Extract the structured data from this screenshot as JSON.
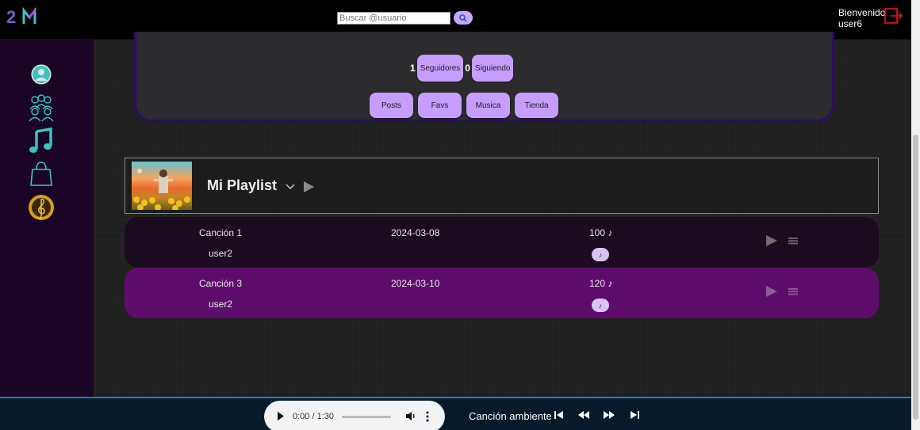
{
  "header": {
    "logo_text": "2M",
    "search_placeholder": "Buscar @usuario",
    "welcome_line1": "Bienvenido",
    "welcome_user": "user6"
  },
  "sidebar": {
    "items": [
      {
        "icon": "profile-icon"
      },
      {
        "icon": "community-icon"
      },
      {
        "icon": "music-note-icon"
      },
      {
        "icon": "shopping-bag-icon"
      },
      {
        "icon": "treble-clef-icon"
      }
    ]
  },
  "profile": {
    "followers_count": "1",
    "followers_label": "Seguidores",
    "following_count": "0",
    "following_label": "Siguiendo",
    "tabs": [
      "Posts",
      "Favs",
      "Musica",
      "Tienda"
    ]
  },
  "playlist": {
    "title": "Mi Playlist",
    "songs": [
      {
        "name": "Canción 1",
        "artist": "user2",
        "date": "2024-03-08",
        "bpm": "100 ♪",
        "highlight": false
      },
      {
        "name": "Canción 3",
        "artist": "user2",
        "date": "2024-03-10",
        "bpm": "120 ♪",
        "highlight": true
      }
    ]
  },
  "player": {
    "time": "0:00 / 1:30",
    "ambient_label": "Canción ambiente"
  },
  "colors": {
    "accent": "#c79dfd",
    "sidebar_bg": "#1a0526",
    "row_default": "#1a0b1f",
    "row_highlight": "#5e0c6c",
    "icon_teal": "#3dc3c0",
    "logout_red": "#e01b1b"
  }
}
